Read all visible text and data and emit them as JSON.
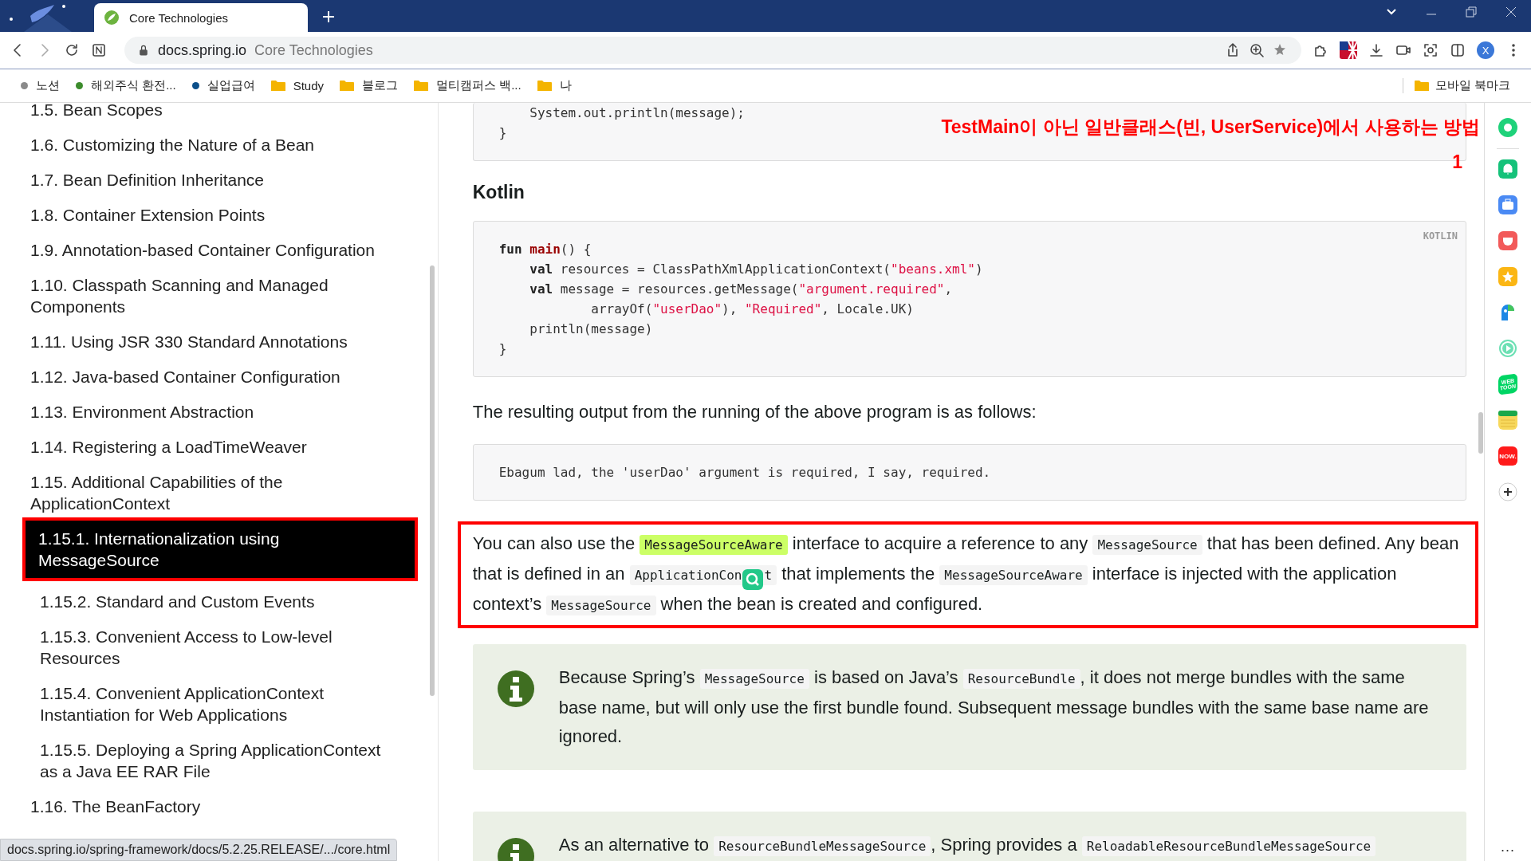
{
  "browser": {
    "tab_title": "Core Technologies",
    "address_domain": "docs.spring.io",
    "address_title": "Core Technologies",
    "avatar_letter": "X",
    "bookmarks": [
      {
        "kind": "dot",
        "label": "노션",
        "color": "#8a8a8a"
      },
      {
        "kind": "dot",
        "label": "해외주식 환전...",
        "color": "#3c8c2c"
      },
      {
        "kind": "dot",
        "label": "실업급여",
        "color": "#0b4f8a"
      },
      {
        "kind": "folder",
        "label": "Study"
      },
      {
        "kind": "folder",
        "label": "블로그"
      },
      {
        "kind": "folder",
        "label": "멀티캠퍼스 백..."
      },
      {
        "kind": "folder",
        "label": "나"
      }
    ],
    "mobile_bookmarks": "모바일 북마크"
  },
  "sidebar": {
    "items": [
      {
        "label": "1.5. Bean Scopes",
        "selected": false
      },
      {
        "label": "1.6. Customizing the Nature of a Bean",
        "selected": false
      },
      {
        "label": "1.7. Bean Definition Inheritance",
        "selected": false
      },
      {
        "label": "1.8. Container Extension Points",
        "selected": false
      },
      {
        "label": "1.9. Annotation-based Container Configuration",
        "selected": false
      },
      {
        "label": "1.10. Classpath Scanning and Managed Components",
        "selected": false
      },
      {
        "label": "1.11. Using JSR 330 Standard Annotations",
        "selected": false
      },
      {
        "label": "1.12. Java-based Container Configuration",
        "selected": false
      },
      {
        "label": "1.13. Environment Abstraction",
        "selected": false
      },
      {
        "label": "1.14. Registering a LoadTimeWeaver",
        "selected": false
      },
      {
        "label": "1.15. Additional Capabilities of the ApplicationContext",
        "selected": false,
        "children": [
          {
            "label": "1.15.1. Internationalization using MessageSource",
            "selected": true
          },
          {
            "label": "1.15.2. Standard and Custom Events",
            "selected": false
          },
          {
            "label": "1.15.3. Convenient Access to Low-level Resources",
            "selected": false
          },
          {
            "label": "1.15.4. Convenient ApplicationContext Instantiation for Web Applications",
            "selected": false
          },
          {
            "label": "1.15.5. Deploying a Spring ApplicationContext as a Java EE RAR File",
            "selected": false
          }
        ]
      },
      {
        "label": "1.16. The BeanFactory",
        "selected": false
      }
    ]
  },
  "annotation": {
    "lines": [
      "TestMain이 아닌 일반클래스(빈, UserService)에서 사용하는 방법",
      "1"
    ]
  },
  "content": [
    {
      "kind": "code",
      "clipped_top": true,
      "lines": [
        [
          {
            "kind": "plain",
            "text": "    System.out.println(message);"
          }
        ],
        [
          {
            "kind": "plain",
            "text": "}"
          }
        ]
      ]
    },
    {
      "kind": "heading",
      "text": "Kotlin"
    },
    {
      "kind": "code",
      "language": "KOTLIN",
      "lines": [
        [
          {
            "kind": "keyword",
            "text": "fun "
          },
          {
            "kind": "function",
            "text": "main"
          },
          {
            "kind": "plain",
            "text": "() {"
          }
        ],
        [
          {
            "kind": "keyword",
            "text": "    val"
          },
          {
            "kind": "plain",
            "text": " resources = ClassPathXmlApplicationContext("
          },
          {
            "kind": "string",
            "text": "\"beans.xml\""
          },
          {
            "kind": "plain",
            "text": ")"
          }
        ],
        [
          {
            "kind": "keyword",
            "text": "    val"
          },
          {
            "kind": "plain",
            "text": " message = resources.getMessage("
          },
          {
            "kind": "string",
            "text": "\"argument.required\""
          },
          {
            "kind": "plain",
            "text": ","
          }
        ],
        [
          {
            "kind": "plain",
            "text": "            arrayOf("
          },
          {
            "kind": "string",
            "text": "\"userDao\""
          },
          {
            "kind": "plain",
            "text": "), "
          },
          {
            "kind": "string",
            "text": "\"Required\""
          },
          {
            "kind": "plain",
            "text": ", Locale.UK)"
          }
        ],
        [
          {
            "kind": "plain",
            "text": "    println(message)"
          }
        ],
        [
          {
            "kind": "plain",
            "text": "}"
          }
        ]
      ]
    },
    {
      "kind": "paragraph",
      "segments": [
        {
          "kind": "text",
          "text": "The resulting output from the running of the above program is as follows:"
        }
      ]
    },
    {
      "kind": "code",
      "lines": [
        [
          {
            "kind": "plain",
            "text": "Ebagum lad, the 'userDao' argument is required, I say, required."
          }
        ]
      ]
    },
    {
      "kind": "paragraph",
      "boxed": true,
      "segments": [
        {
          "kind": "text",
          "text": "You can also use the "
        },
        {
          "kind": "highlight",
          "text": "MessageSourceAware"
        },
        {
          "kind": "text",
          "text": " interface to acquire a reference to any "
        },
        {
          "kind": "code",
          "text": "MessageSource"
        },
        {
          "kind": "text",
          "text": " that has been defined. Any bean that is defined in an "
        },
        {
          "kind": "covered_code",
          "text": "ApplicationCon",
          "after_icon": "t"
        },
        {
          "kind": "text",
          "text": " that implements the "
        },
        {
          "kind": "code",
          "text": "MessageSourceAware"
        },
        {
          "kind": "text",
          "text": " interface is injected with the application context’s "
        },
        {
          "kind": "code",
          "text": "MessageSource"
        },
        {
          "kind": "text",
          "text": " when the bean is created and configured."
        }
      ]
    },
    {
      "kind": "note",
      "segments": [
        {
          "kind": "text",
          "text": "Because Spring’s "
        },
        {
          "kind": "code",
          "text": "MessageSource"
        },
        {
          "kind": "text",
          "text": " is based on Java’s "
        },
        {
          "kind": "code",
          "text": "ResourceBundle"
        },
        {
          "kind": "text",
          "text": ", it does not merge bundles with the same base name, but will only use the first bundle found. Subsequent message bundles with the same base name are ignored."
        }
      ]
    },
    {
      "kind": "note",
      "segments": [
        {
          "kind": "text",
          "text": "As an alternative to "
        },
        {
          "kind": "code",
          "text": "ResourceBundleMessageSource"
        },
        {
          "kind": "text",
          "text": ", Spring provides a "
        },
        {
          "kind": "code",
          "text": "ReloadableResourceBundleMessageSource"
        }
      ]
    }
  ],
  "side_panel": {
    "apps": [
      {
        "kind": "ring"
      },
      {
        "kind": "bell"
      },
      {
        "kind": "briefcase"
      },
      {
        "kind": "pocket"
      },
      {
        "kind": "star"
      },
      {
        "kind": "parrot"
      },
      {
        "kind": "play"
      },
      {
        "kind": "webtoon",
        "label": "WEB TOON"
      },
      {
        "kind": "notes"
      },
      {
        "kind": "now",
        "label": "NOW."
      },
      {
        "kind": "add"
      }
    ],
    "more": "..."
  },
  "status_bar": {
    "url": "docs.spring.io/spring-framework/docs/5.2.25.RELEASE/.../core.html"
  }
}
